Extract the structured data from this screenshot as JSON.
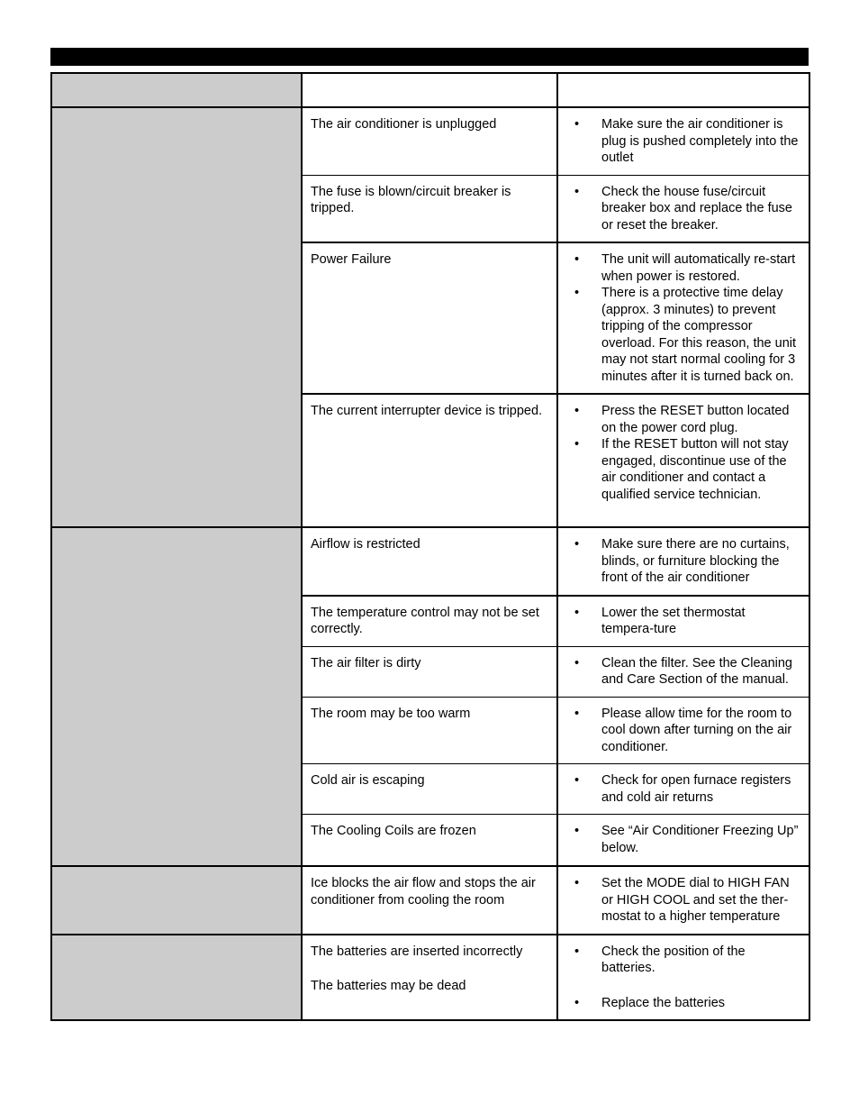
{
  "page": {
    "header_bar": {
      "label": "",
      "color": "#000000"
    }
  },
  "table": {
    "colors": {
      "problem_column_bg": "#cccccc",
      "cell_bg": "#ffffff",
      "border": "#000000"
    },
    "header_row": {
      "problem": "",
      "cause": "",
      "fix": ""
    },
    "sections": [
      {
        "problem": "",
        "rows": [
          {
            "cause": "The air conditioner is unplugged",
            "fixes": [
              "Make sure the air conditioner is plug is pushed completely into the outlet"
            ]
          },
          {
            "cause": "The fuse is blown/circuit breaker is tripped.",
            "fixes": [
              "Check the house fuse/circuit breaker box and replace the fuse or reset the breaker."
            ]
          },
          {
            "cause": "Power Failure",
            "fixes": [
              "The unit will automatically re-start when power is restored.",
              "There is a protective time delay (approx. 3 minutes) to prevent tripping of the compressor overload. For this reason, the unit may not start normal cooling for 3 minutes after it is turned back on."
            ]
          },
          {
            "cause": "The current interrupter device is tripped.",
            "fixes": [
              "Press the RESET button located on the power cord plug.",
              "If the RESET button will not stay engaged, discontinue use of the air conditioner and contact a qualified service technician."
            ]
          }
        ]
      },
      {
        "problem": "",
        "rows": [
          {
            "cause": "Airflow is restricted",
            "fixes": [
              "Make sure there are no curtains, blinds, or furniture blocking the front of the air conditioner"
            ]
          },
          {
            "cause": "The temperature control may not be set correctly.",
            "fixes": [
              "Lower the set thermostat tempera-ture"
            ]
          },
          {
            "cause": "The air filter is dirty",
            "fixes": [
              "Clean the filter. See the Cleaning and Care Section of the manual."
            ]
          },
          {
            "cause": "The room may be too warm",
            "fixes": [
              "Please allow time for the room to cool down after turning on the air conditioner."
            ]
          },
          {
            "cause": "Cold air is escaping",
            "fixes": [
              "Check for open furnace registers and cold air returns"
            ]
          },
          {
            "cause": "The Cooling Coils are frozen",
            "fixes": [
              "See “Air Conditioner Freezing Up” below."
            ]
          }
        ]
      },
      {
        "problem": "",
        "rows": [
          {
            "cause": "Ice blocks the air flow and stops the air conditioner from cooling the room",
            "fixes": [
              "Set the MODE dial to HIGH FAN or HIGH COOL and set the ther-mostat to a higher temperature"
            ]
          }
        ]
      },
      {
        "problem": "",
        "rows": [
          {
            "cause_lines": [
              "The batteries are inserted incorrectly",
              "The batteries may be dead"
            ],
            "fixes": [
              "Check the position of the batteries.",
              "Replace the batteries"
            ]
          }
        ]
      }
    ]
  },
  "icons": {
    "bullet": "•"
  }
}
